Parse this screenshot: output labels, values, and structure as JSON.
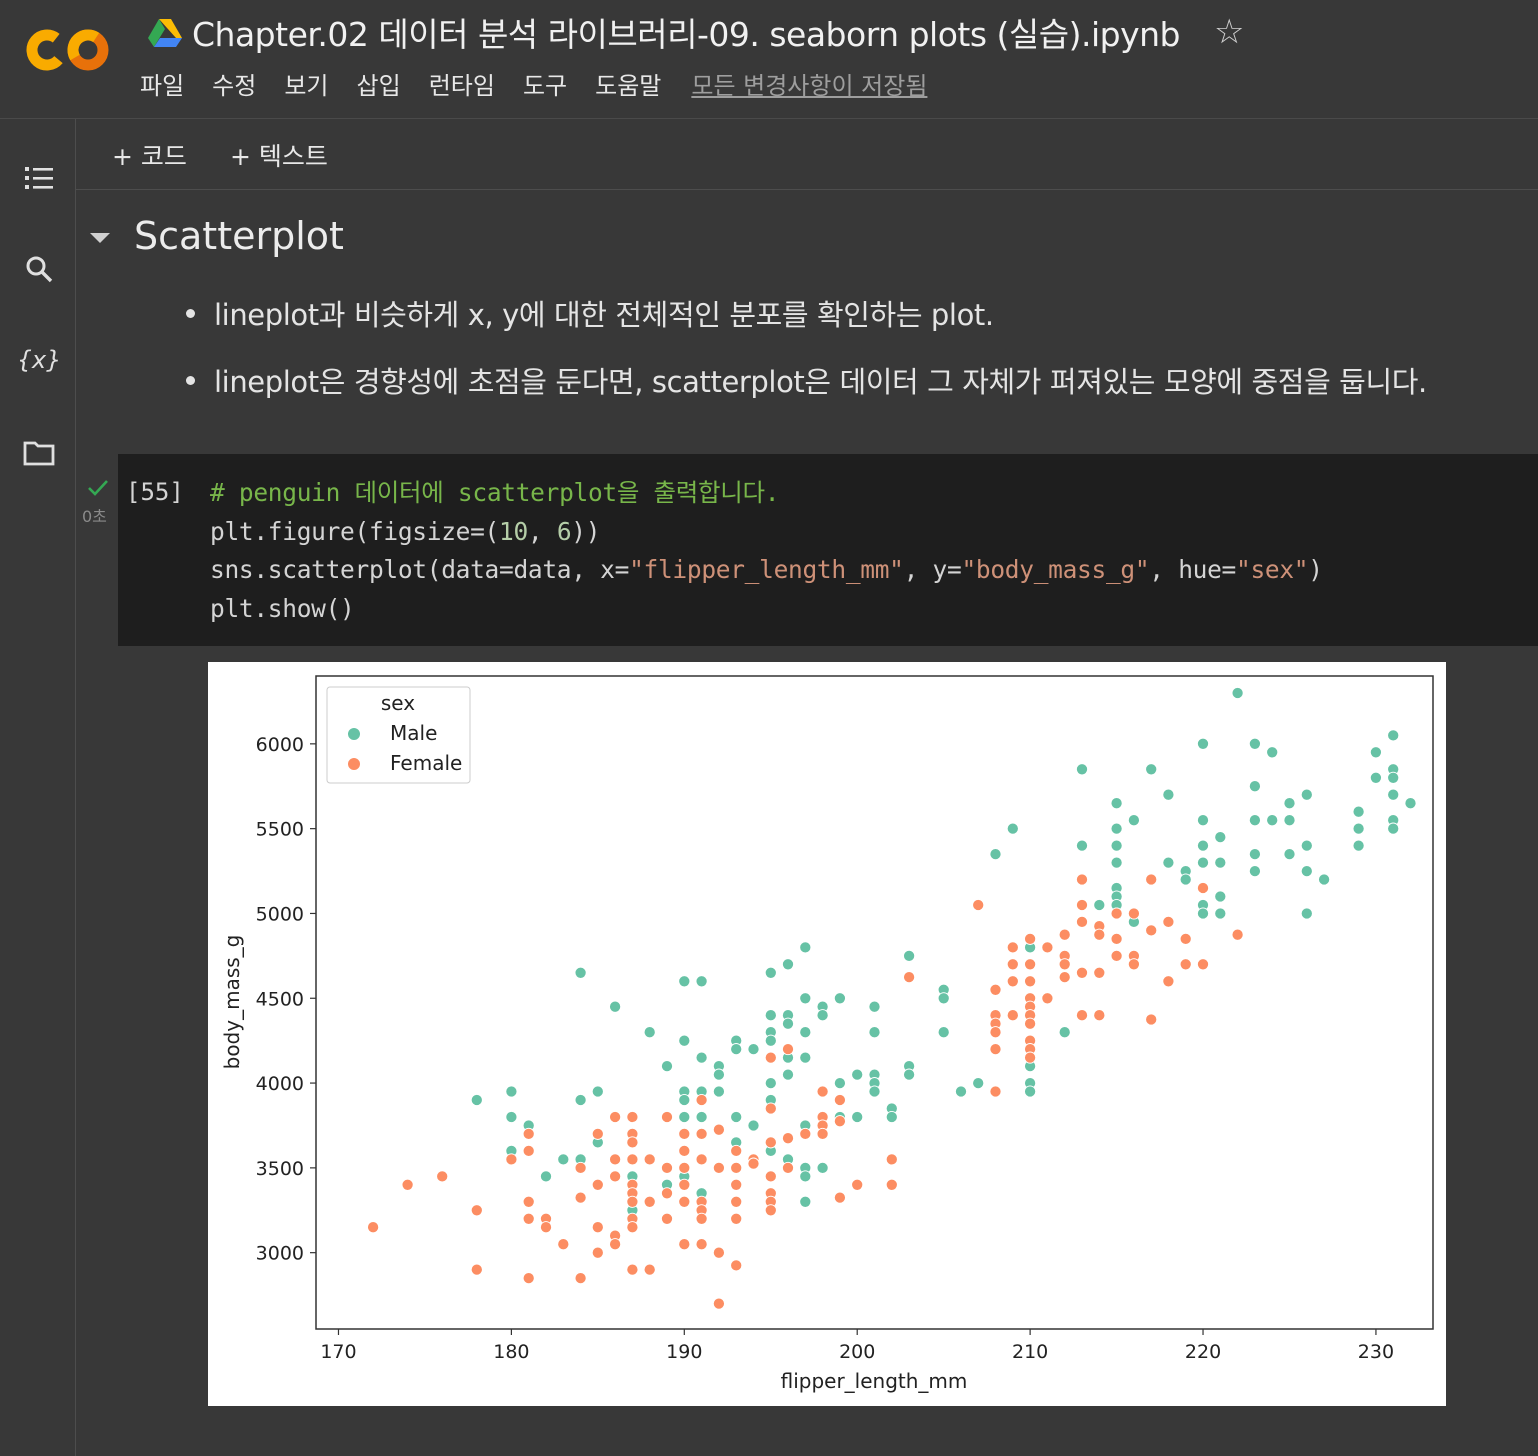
{
  "header": {
    "title": "Chapter.02 데이터 분석 라이브러리-09. seaborn plots (실습).ipynb",
    "menu": [
      "파일",
      "수정",
      "보기",
      "삽입",
      "런타임",
      "도구",
      "도움말"
    ],
    "save_status": "모든 변경사항이 저장됨"
  },
  "toolbar": {
    "add_code": "+ 코드",
    "add_text": "+ 텍스트"
  },
  "section": {
    "title": "Scatterplot",
    "bullets": [
      "lineplot과 비슷하게 x, y에 대한 전체적인 분포를 확인하는 plot.",
      "lineplot은 경향성에 초점을 둔다면, scatterplot은 데이터 그 자체가 퍼져있는 모양에 중점을 둡니다."
    ]
  },
  "cell": {
    "execution_count": "[55]",
    "run_time": "0초",
    "code_comment": "# penguin 데이터에 scatterplot을 출력합니다.",
    "code_line2_a": "plt.figure(figsize=(",
    "code_line2_n1": "10",
    "code_line2_b": ", ",
    "code_line2_n2": "6",
    "code_line2_c": "))",
    "code_line3_a": "sns.scatterplot(data=data, x=",
    "code_line3_s1": "\"flipper_length_mm\"",
    "code_line3_b": ", y=",
    "code_line3_s2": "\"body_mass_g\"",
    "code_line3_c": ", hue=",
    "code_line3_s3": "\"sex\"",
    "code_line3_d": ")",
    "code_line4": "plt.show()"
  },
  "colors": {
    "male": "#66c2a5",
    "female": "#fc8d62",
    "check": "#34a853"
  },
  "chart_data": {
    "type": "scatter",
    "xlabel": "flipper_length_mm",
    "ylabel": "body_mass_g",
    "xlim": [
      168.7,
      233.3
    ],
    "ylim": [
      2550,
      6400
    ],
    "xticks": [
      170,
      180,
      190,
      200,
      210,
      220,
      230
    ],
    "yticks": [
      3000,
      3500,
      4000,
      4500,
      5000,
      5500,
      6000
    ],
    "grid": false,
    "legend": {
      "title": "sex",
      "placement": "top-left"
    },
    "series": [
      {
        "name": "Male",
        "color": "#66c2a5",
        "points": [
          [
            178,
            3900
          ],
          [
            180,
            3950
          ],
          [
            180,
            3800
          ],
          [
            180,
            3600
          ],
          [
            181,
            3750
          ],
          [
            181,
            3700
          ],
          [
            182,
            3450
          ],
          [
            183,
            3550
          ],
          [
            184,
            4650
          ],
          [
            184,
            3900
          ],
          [
            184,
            3550
          ],
          [
            185,
            3950
          ],
          [
            185,
            3650
          ],
          [
            186,
            4450
          ],
          [
            187,
            3450
          ],
          [
            187,
            3250
          ],
          [
            188,
            4300
          ],
          [
            189,
            4100
          ],
          [
            189,
            3400
          ],
          [
            190,
            4600
          ],
          [
            190,
            4250
          ],
          [
            190,
            3950
          ],
          [
            190,
            3900
          ],
          [
            190,
            3800
          ],
          [
            190,
            3700
          ],
          [
            190,
            3450
          ],
          [
            191,
            4600
          ],
          [
            191,
            4150
          ],
          [
            191,
            3950
          ],
          [
            191,
            3800
          ],
          [
            191,
            3350
          ],
          [
            192,
            4100
          ],
          [
            192,
            4050
          ],
          [
            192,
            3950
          ],
          [
            193,
            4250
          ],
          [
            193,
            4200
          ],
          [
            193,
            3800
          ],
          [
            193,
            3650
          ],
          [
            194,
            4200
          ],
          [
            194,
            3750
          ],
          [
            195,
            4650
          ],
          [
            195,
            4400
          ],
          [
            195,
            4300
          ],
          [
            195,
            4250
          ],
          [
            195,
            4000
          ],
          [
            195,
            3900
          ],
          [
            195,
            3600
          ],
          [
            196,
            4700
          ],
          [
            196,
            4400
          ],
          [
            196,
            4350
          ],
          [
            196,
            4150
          ],
          [
            196,
            4050
          ],
          [
            196,
            3550
          ],
          [
            197,
            4800
          ],
          [
            197,
            4500
          ],
          [
            197,
            4300
          ],
          [
            197,
            4150
          ],
          [
            197,
            3750
          ],
          [
            197,
            3500
          ],
          [
            197,
            3450
          ],
          [
            197,
            3300
          ],
          [
            198,
            4450
          ],
          [
            198,
            4400
          ],
          [
            198,
            3700
          ],
          [
            198,
            3500
          ],
          [
            199,
            4500
          ],
          [
            199,
            4000
          ],
          [
            199,
            3800
          ],
          [
            200,
            4050
          ],
          [
            200,
            3800
          ],
          [
            201,
            4450
          ],
          [
            201,
            4300
          ],
          [
            201,
            4050
          ],
          [
            201,
            4000
          ],
          [
            201,
            3950
          ],
          [
            202,
            3850
          ],
          [
            202,
            3800
          ],
          [
            203,
            4750
          ],
          [
            203,
            4100
          ],
          [
            203,
            4050
          ],
          [
            205,
            4550
          ],
          [
            205,
            4500
          ],
          [
            205,
            4300
          ],
          [
            206,
            3950
          ],
          [
            207,
            4000
          ],
          [
            208,
            5350
          ],
          [
            209,
            5500
          ],
          [
            210,
            4800
          ],
          [
            210,
            4100
          ],
          [
            210,
            4000
          ],
          [
            210,
            3950
          ],
          [
            212,
            4300
          ],
          [
            213,
            5850
          ],
          [
            213,
            5400
          ],
          [
            214,
            5050
          ],
          [
            215,
            5650
          ],
          [
            215,
            5500
          ],
          [
            215,
            5400
          ],
          [
            215,
            5300
          ],
          [
            215,
            5150
          ],
          [
            215,
            5100
          ],
          [
            215,
            5050
          ],
          [
            215,
            5000
          ],
          [
            216,
            5550
          ],
          [
            216,
            4950
          ],
          [
            217,
            5850
          ],
          [
            218,
            5700
          ],
          [
            218,
            5300
          ],
          [
            219,
            5250
          ],
          [
            219,
            5200
          ],
          [
            220,
            6000
          ],
          [
            220,
            5550
          ],
          [
            220,
            5400
          ],
          [
            220,
            5300
          ],
          [
            220,
            5050
          ],
          [
            220,
            5000
          ],
          [
            221,
            5450
          ],
          [
            221,
            5300
          ],
          [
            221,
            5100
          ],
          [
            221,
            5000
          ],
          [
            222,
            6300
          ],
          [
            223,
            6000
          ],
          [
            223,
            5750
          ],
          [
            223,
            5550
          ],
          [
            223,
            5350
          ],
          [
            223,
            5250
          ],
          [
            224,
            5950
          ],
          [
            224,
            5550
          ],
          [
            225,
            5650
          ],
          [
            225,
            5550
          ],
          [
            225,
            5350
          ],
          [
            226,
            5700
          ],
          [
            226,
            5400
          ],
          [
            226,
            5250
          ],
          [
            226,
            5000
          ],
          [
            227,
            5200
          ],
          [
            229,
            5600
          ],
          [
            229,
            5500
          ],
          [
            229,
            5400
          ],
          [
            230,
            5950
          ],
          [
            230,
            5800
          ],
          [
            231,
            6050
          ],
          [
            231,
            5850
          ],
          [
            231,
            5800
          ],
          [
            231,
            5700
          ],
          [
            231,
            5550
          ],
          [
            231,
            5500
          ],
          [
            232,
            5650
          ]
        ]
      },
      {
        "name": "Female",
        "color": "#fc8d62",
        "points": [
          [
            172,
            3150
          ],
          [
            174,
            3400
          ],
          [
            176,
            3450
          ],
          [
            178,
            3250
          ],
          [
            178,
            2900
          ],
          [
            180,
            3550
          ],
          [
            181,
            3700
          ],
          [
            181,
            3600
          ],
          [
            181,
            3300
          ],
          [
            181,
            3200
          ],
          [
            181,
            2850
          ],
          [
            182,
            3200
          ],
          [
            182,
            3150
          ],
          [
            183,
            3050
          ],
          [
            184,
            3500
          ],
          [
            184,
            3325
          ],
          [
            184,
            2850
          ],
          [
            185,
            3700
          ],
          [
            185,
            3400
          ],
          [
            185,
            3150
          ],
          [
            185,
            3000
          ],
          [
            186,
            3800
          ],
          [
            186,
            3550
          ],
          [
            186,
            3450
          ],
          [
            186,
            3100
          ],
          [
            186,
            3050
          ],
          [
            187,
            3800
          ],
          [
            187,
            3700
          ],
          [
            187,
            3650
          ],
          [
            187,
            3550
          ],
          [
            187,
            3400
          ],
          [
            187,
            3350
          ],
          [
            187,
            3300
          ],
          [
            187,
            3200
          ],
          [
            187,
            3150
          ],
          [
            187,
            2900
          ],
          [
            188,
            3550
          ],
          [
            188,
            3300
          ],
          [
            188,
            2900
          ],
          [
            189,
            3800
          ],
          [
            189,
            3500
          ],
          [
            189,
            3200
          ],
          [
            189,
            3350
          ],
          [
            190,
            3700
          ],
          [
            190,
            3600
          ],
          [
            190,
            3500
          ],
          [
            190,
            3400
          ],
          [
            190,
            3300
          ],
          [
            190,
            3050
          ],
          [
            191,
            3900
          ],
          [
            191,
            3700
          ],
          [
            191,
            3550
          ],
          [
            191,
            3300
          ],
          [
            191,
            3250
          ],
          [
            191,
            3200
          ],
          [
            191,
            3050
          ],
          [
            192,
            3725
          ],
          [
            192,
            3500
          ],
          [
            192,
            3000
          ],
          [
            192,
            2700
          ],
          [
            193,
            3600
          ],
          [
            193,
            3500
          ],
          [
            193,
            3400
          ],
          [
            193,
            3300
          ],
          [
            193,
            3200
          ],
          [
            193,
            2925
          ],
          [
            194,
            3550
          ],
          [
            194,
            3525
          ],
          [
            195,
            4150
          ],
          [
            195,
            3850
          ],
          [
            195,
            3650
          ],
          [
            195,
            3450
          ],
          [
            195,
            3350
          ],
          [
            195,
            3300
          ],
          [
            195,
            3250
          ],
          [
            196,
            4200
          ],
          [
            196,
            3675
          ],
          [
            196,
            3500
          ],
          [
            197,
            3700
          ],
          [
            198,
            3950
          ],
          [
            198,
            3800
          ],
          [
            198,
            3750
          ],
          [
            198,
            3700
          ],
          [
            199,
            3900
          ],
          [
            199,
            3775
          ],
          [
            199,
            3325
          ],
          [
            200,
            3400
          ],
          [
            202,
            3550
          ],
          [
            202,
            3400
          ],
          [
            203,
            4625
          ],
          [
            207,
            5050
          ],
          [
            208,
            4550
          ],
          [
            208,
            4400
          ],
          [
            208,
            4350
          ],
          [
            208,
            4300
          ],
          [
            208,
            4200
          ],
          [
            208,
            3950
          ],
          [
            209,
            4800
          ],
          [
            209,
            4700
          ],
          [
            209,
            4600
          ],
          [
            209,
            4400
          ],
          [
            210,
            4850
          ],
          [
            210,
            4700
          ],
          [
            210,
            4600
          ],
          [
            210,
            4500
          ],
          [
            210,
            4450
          ],
          [
            210,
            4400
          ],
          [
            210,
            4350
          ],
          [
            210,
            4250
          ],
          [
            210,
            4200
          ],
          [
            210,
            4150
          ],
          [
            211,
            4800
          ],
          [
            211,
            4500
          ],
          [
            212,
            4875
          ],
          [
            212,
            4750
          ],
          [
            212,
            4700
          ],
          [
            212,
            4625
          ],
          [
            213,
            5200
          ],
          [
            213,
            5050
          ],
          [
            213,
            4950
          ],
          [
            213,
            4650
          ],
          [
            213,
            4400
          ],
          [
            214,
            4925
          ],
          [
            214,
            4875
          ],
          [
            214,
            4650
          ],
          [
            214,
            4400
          ],
          [
            215,
            5000
          ],
          [
            215,
            4850
          ],
          [
            215,
            4750
          ],
          [
            216,
            5000
          ],
          [
            216,
            4750
          ],
          [
            216,
            4700
          ],
          [
            217,
            4900
          ],
          [
            217,
            4375
          ],
          [
            217,
            5200
          ],
          [
            218,
            4950
          ],
          [
            218,
            4600
          ],
          [
            219,
            4850
          ],
          [
            219,
            4700
          ],
          [
            220,
            5150
          ],
          [
            220,
            4700
          ],
          [
            222,
            4875
          ]
        ]
      }
    ]
  }
}
